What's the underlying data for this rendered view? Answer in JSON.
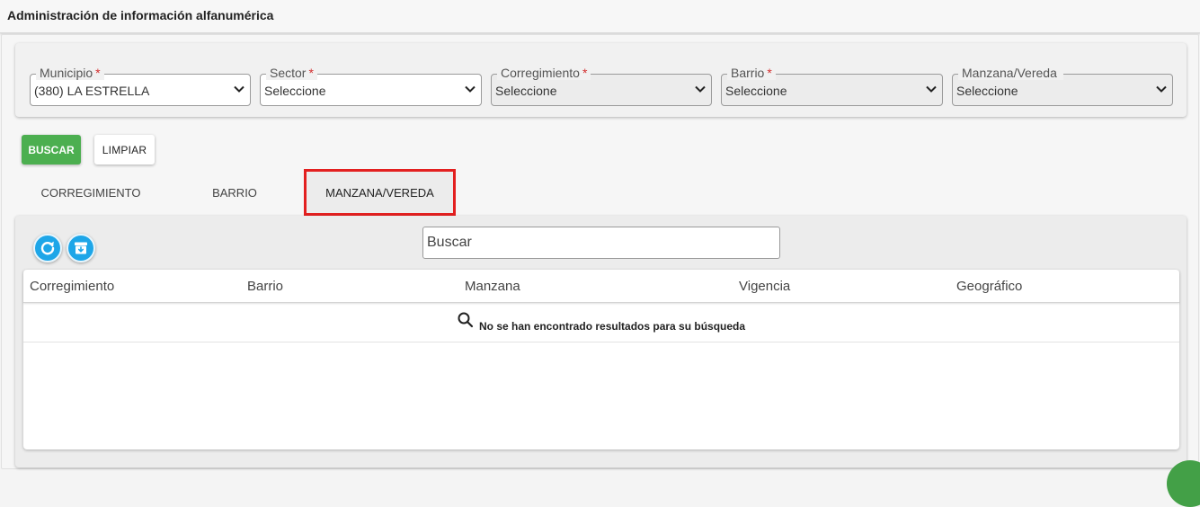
{
  "header": {
    "title": "Administración de información alfanumérica"
  },
  "filters": [
    {
      "label": "Municipio",
      "required": "*",
      "value": "(380) LA ESTRELLA",
      "disabled": false
    },
    {
      "label": "Sector",
      "required": "*",
      "value": "Seleccione",
      "disabled": false
    },
    {
      "label": "Corregimiento",
      "required": "*",
      "value": "Seleccione",
      "disabled": true
    },
    {
      "label": "Barrio",
      "required": "*",
      "value": "Seleccione",
      "disabled": true
    },
    {
      "label": "Manzana/Vereda",
      "required": "",
      "value": "Seleccione",
      "disabled": true
    }
  ],
  "actions": {
    "search_label": "BUSCAR",
    "clear_label": "LIMPIAR"
  },
  "tabs": [
    {
      "label": "CORREGIMIENTO"
    },
    {
      "label": "BARRIO"
    },
    {
      "label": "MANZANA/VEREDA",
      "selected": true
    }
  ],
  "toolbar": {
    "refresh_icon": "refresh-icon",
    "archive_icon": "archive-download-icon",
    "search_placeholder": "Buscar"
  },
  "table": {
    "columns": [
      "Corregimiento",
      "Barrio",
      "Manzana",
      "Vigencia",
      "Geográfico"
    ],
    "empty_message": "No se han encontrado resultados para su búsqueda"
  },
  "colors": {
    "primary_green": "#4caf50",
    "accent_blue": "#1ea6e8",
    "highlight_red": "#e32020",
    "required_red": "#d32f2f"
  }
}
